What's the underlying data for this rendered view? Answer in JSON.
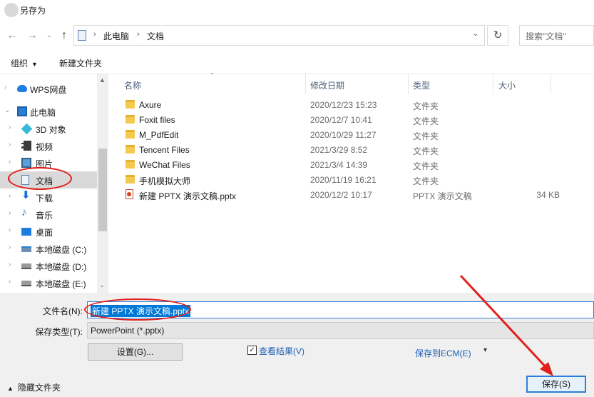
{
  "window": {
    "title": "另存为"
  },
  "nav": {
    "back": "←",
    "forward": "→",
    "recent": "⌄",
    "up": "↑",
    "breadcrumb": [
      "此电脑",
      "文档"
    ],
    "separator": "›",
    "dropdown": "⌄",
    "refresh": "↻",
    "search_placeholder": "搜索\"文档\""
  },
  "toolbar": {
    "organize": "组织",
    "organize_caret": "▼",
    "new_folder": "新建文件夹"
  },
  "sidebar": {
    "items": [
      {
        "label": "WPS网盘",
        "icon": "cloud-icon",
        "arrow": "›"
      },
      {
        "label": "此电脑",
        "icon": "pc-icon",
        "arrow": "⌄"
      },
      {
        "label": "3D 对象",
        "icon": "cube-icon",
        "arrow": "›"
      },
      {
        "label": "视频",
        "icon": "video-icon",
        "arrow": "›"
      },
      {
        "label": "图片",
        "icon": "picture-icon",
        "arrow": "›"
      },
      {
        "label": "文档",
        "icon": "document-icon",
        "arrow": "›",
        "selected": true
      },
      {
        "label": "下载",
        "icon": "download-icon",
        "arrow": "›",
        "glyph": "⬇"
      },
      {
        "label": "音乐",
        "icon": "music-icon",
        "arrow": "›",
        "glyph": "♪"
      },
      {
        "label": "桌面",
        "icon": "desktop-icon",
        "arrow": "›"
      },
      {
        "label": "本地磁盘 (C:)",
        "icon": "drive-c-icon",
        "arrow": "›"
      },
      {
        "label": "本地磁盘 (D:)",
        "icon": "drive-icon",
        "arrow": "›"
      },
      {
        "label": "本地磁盘 (E:)",
        "icon": "drive-icon",
        "arrow": "›"
      }
    ],
    "scroll_up": "▲",
    "scroll_down": "⌄"
  },
  "files": {
    "columns": {
      "name": "名称",
      "date": "修改日期",
      "type": "类型",
      "size": "大小",
      "sort": "⌃"
    },
    "rows": [
      {
        "name": "Axure",
        "date": "2020/12/23 15:23",
        "type": "文件夹",
        "size": "",
        "kind": "folder"
      },
      {
        "name": "Foxit files",
        "date": "2020/12/7 10:41",
        "type": "文件夹",
        "size": "",
        "kind": "folder"
      },
      {
        "name": "M_PdfEdit",
        "date": "2020/10/29 11:27",
        "type": "文件夹",
        "size": "",
        "kind": "folder"
      },
      {
        "name": "Tencent Files",
        "date": "2021/3/29 8:52",
        "type": "文件夹",
        "size": "",
        "kind": "folder"
      },
      {
        "name": "WeChat Files",
        "date": "2021/3/4 14:39",
        "type": "文件夹",
        "size": "",
        "kind": "folder"
      },
      {
        "name": "手机模拟大师",
        "date": "2020/11/19 16:21",
        "type": "文件夹",
        "size": "",
        "kind": "folder"
      },
      {
        "name": "新建 PPTX 演示文稿.pptx",
        "date": "2020/12/2 10:17",
        "type": "PPTX 演示文稿",
        "size": "34 KB",
        "kind": "pptx"
      }
    ]
  },
  "form": {
    "filename_label": "文件名(N):",
    "filename_value": "新建 PPTX 演示文稿.pptx",
    "filetype_label": "保存类型(T):",
    "filetype_value": "PowerPoint (*.pptx)",
    "settings_button": "设置(G)...",
    "view_result_checked": "✓",
    "view_result_label": "查看结果(V)",
    "save_ecm_label": "保存到ECM(E)",
    "save_ecm_caret": "▾",
    "hide_folders_caret": "▲",
    "hide_folders": "隐藏文件夹",
    "save_button": "保存(S)"
  },
  "annotation_color": "#e0201c"
}
